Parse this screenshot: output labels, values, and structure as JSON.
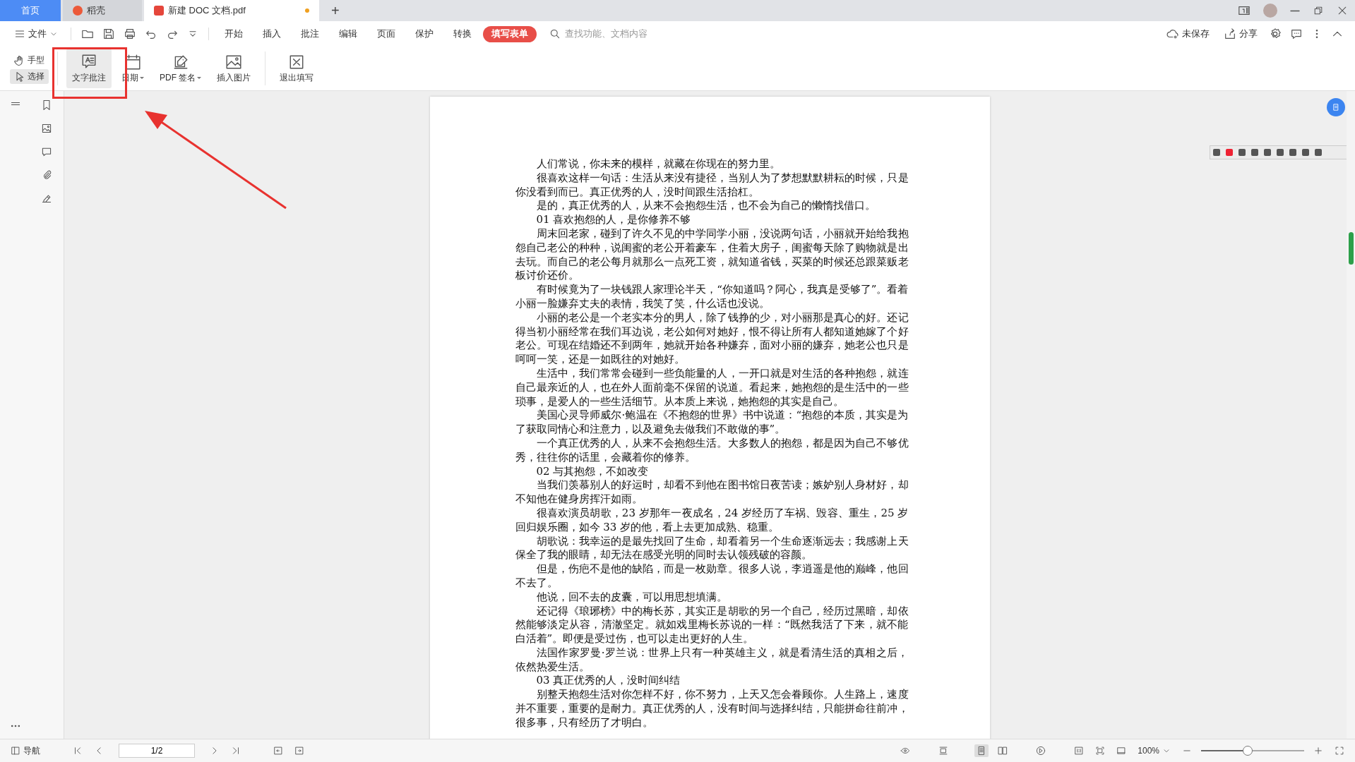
{
  "tabs": [
    {
      "label": "首页",
      "kind": "home",
      "selected": false
    },
    {
      "label": "稻壳",
      "kind": "app",
      "selected": false
    },
    {
      "label": "新建 DOC 文档.pdf",
      "kind": "doc",
      "selected": true,
      "modified": true
    }
  ],
  "new_tab": "+",
  "menu": {
    "file": "文件",
    "items": [
      {
        "label": "开始",
        "selected": false
      },
      {
        "label": "插入",
        "selected": false
      },
      {
        "label": "批注",
        "selected": false
      },
      {
        "label": "编辑",
        "selected": false
      },
      {
        "label": "页面",
        "selected": false
      },
      {
        "label": "保护",
        "selected": false
      },
      {
        "label": "转换",
        "selected": false
      },
      {
        "label": "填写表单",
        "selected": true
      }
    ],
    "search": {
      "placeholder": "查找功能、文档内容"
    },
    "save_status": "未保存",
    "share": "分享"
  },
  "ribbon": {
    "modes": [
      {
        "label": "手型",
        "kind": "hand",
        "selected": false
      },
      {
        "label": "选择",
        "kind": "select",
        "selected": true
      }
    ],
    "tools": [
      {
        "label": "文字批注",
        "kind": "comment",
        "selected": true,
        "dropdown": false
      },
      {
        "label": "日期",
        "kind": "date",
        "selected": false,
        "dropdown": true
      },
      {
        "label": "PDF 签名",
        "kind": "sign",
        "selected": false,
        "dropdown": true
      },
      {
        "label": "插入图片",
        "kind": "image",
        "selected": false,
        "dropdown": false
      },
      {
        "label": "退出填写",
        "kind": "exit",
        "selected": false,
        "dropdown": false
      }
    ]
  },
  "document": {
    "paragraphs": [
      "人们常说，你未来的模样，就藏在你现在的努力里。",
      "很喜欢这样一句话：生活从来没有捷径，当别人为了梦想默默耕耘的时候，只是你没看到而已。真正优秀的人，没时间跟生活抬杠。",
      "是的，真正优秀的人，从来不会抱怨生活，也不会为自己的懒惰找借口。",
      "01  喜欢抱怨的人，是你修养不够",
      "周末回老家，碰到了许久不见的中学同学小丽，没说两句话，小丽就开始给我抱怨自己老公的种种，说闺蜜的老公开着豪车，住着大房子，闺蜜每天除了购物就是出去玩。而自己的老公每月就那么一点死工资，就知道省钱，买菜的时候还总跟菜贩老板讨价还价。",
      "有时候竟为了一块钱跟人家理论半天，“你知道吗？阿心，我真是受够了”。看着小丽一脸嫌弃丈夫的表情，我笑了笑，什么话也没说。",
      "小丽的老公是一个老实本分的男人，除了钱挣的少，对小丽那是真心的好。还记得当初小丽经常在我们耳边说，老公如何对她好，恨不得让所有人都知道她嫁了个好老公。可现在结婚还不到两年，她就开始各种嫌弃，面对小丽的嫌弃，她老公也只是呵呵一笑，还是一如既往的对她好。",
      "生活中，我们常常会碰到一些负能量的人，一开口就是对生活的各种抱怨，就连自己最亲近的人，也在外人面前毫不保留的说道。看起来，她抱怨的是生活中的一些琐事，是爱人的一些生活细节。从本质上来说，她抱怨的其实是自己。",
      "美国心灵导师威尔·鲍温在《不抱怨的世界》书中说道：“抱怨的本质，其实是为了获取同情心和注意力，以及避免去做我们不敢做的事”。",
      "一个真正优秀的人，从来不会抱怨生活。大多数人的抱怨，都是因为自己不够优秀，往往你的话里，会藏着你的修养。",
      "02  与其抱怨，不如改变",
      "当我们羡慕别人的好运时，却看不到他在图书馆日夜苦读；嫉妒别人身材好，却不知他在健身房挥汗如雨。",
      "很喜欢演员胡歌，23 岁那年一夜成名，24 岁经历了车祸、毁容、重生，25 岁回归娱乐圈，如今 33 岁的他，看上去更加成熟、稳重。",
      "胡歌说：我幸运的是最先找回了生命，却看着另一个生命逐渐远去；我感谢上天保全了我的眼睛，却无法在感受光明的同时去认领残破的容颜。",
      "但是，伤疤不是他的缺陷，而是一枚勋章。很多人说，李逍遥是他的巅峰，他回不去了。",
      "他说，回不去的皮囊，可以用思想填满。",
      "还记得《琅琊榜》中的梅长苏，其实正是胡歌的另一个自己，经历过黑暗，却依然能够淡定从容，清澈坚定。就如戏里梅长苏说的一样：“既然我活了下来，就不能白活着”。即便是受过伤，也可以走出更好的人生。",
      "法国作家罗曼·罗兰说：世界上只有一种英雄主义，就是看清生活的真相之后，依然热爱生活。",
      "03  真正优秀的人，没时间纠结",
      "别整天抱怨生活对你怎样不好，你不努力，上天又怎会眷顾你。人生路上，速度并不重要，重要的是耐力。真正优秀的人，没有时间与选择纠结，只能拼命往前冲，很多事，只有经历了才明白。"
    ]
  },
  "status_bar": {
    "nav": "导航",
    "page": "1/2",
    "zoom": "100%",
    "zoom_slider": {
      "level": 0.45
    }
  }
}
